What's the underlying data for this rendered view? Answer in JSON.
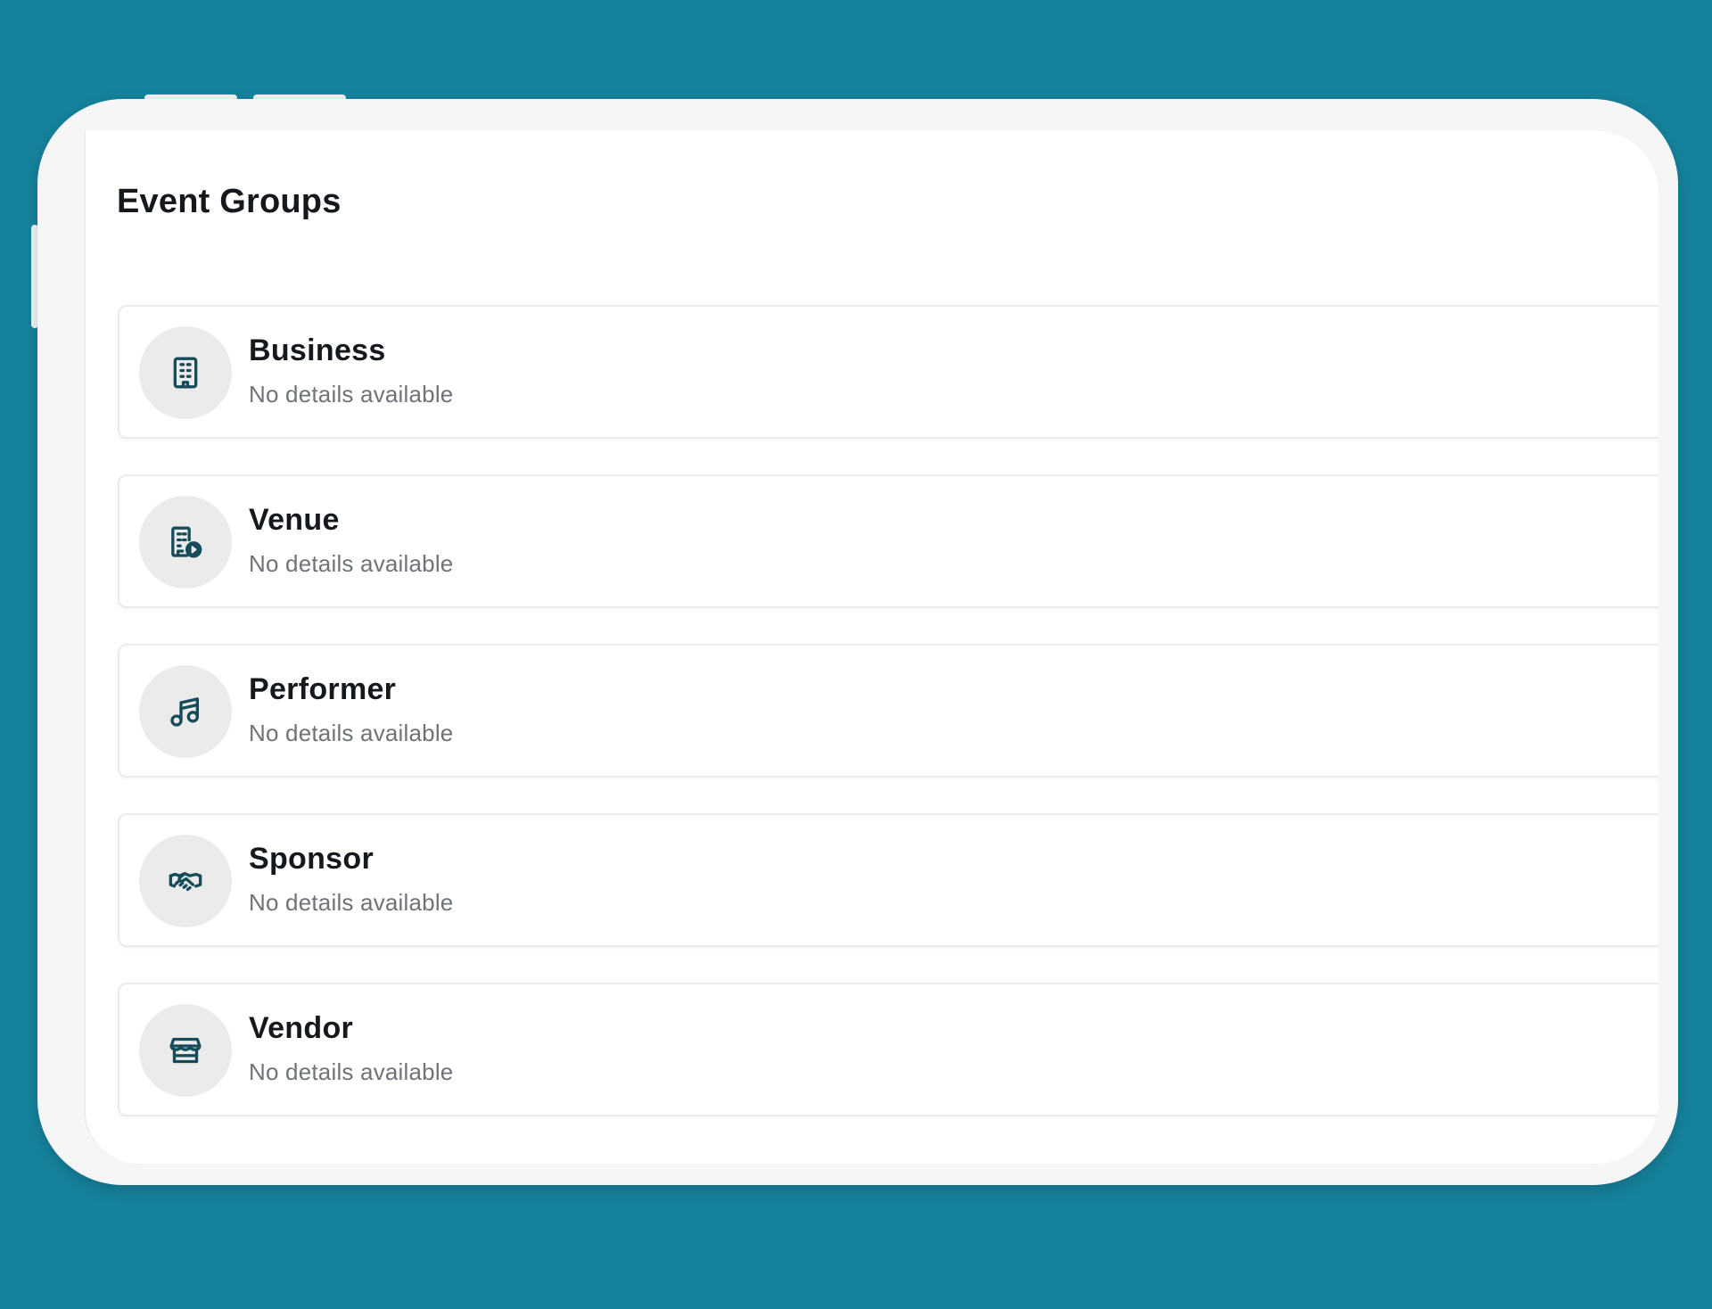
{
  "page": {
    "title": "Event Groups"
  },
  "colors": {
    "background": "#16839d",
    "icon": "#164b5a",
    "icon_bg": "#ebebeb",
    "text_primary": "#15191d",
    "text_secondary": "#6f7378"
  },
  "groups": [
    {
      "name": "Business",
      "description": "No details available",
      "icon": "building-icon"
    },
    {
      "name": "Venue",
      "description": "No details available",
      "icon": "venue-icon"
    },
    {
      "name": "Performer",
      "description": "No details available",
      "icon": "music-note-icon"
    },
    {
      "name": "Sponsor",
      "description": "No details available",
      "icon": "handshake-icon"
    },
    {
      "name": "Vendor",
      "description": "No details available",
      "icon": "store-icon"
    }
  ]
}
